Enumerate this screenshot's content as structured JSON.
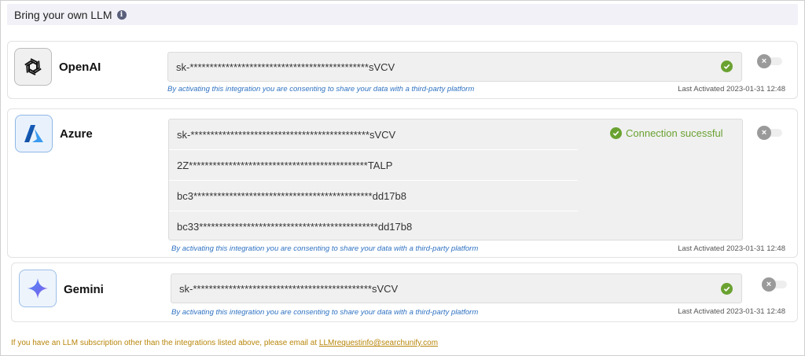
{
  "header": {
    "title": "Bring your own LLM",
    "info_icon": "i"
  },
  "providers": {
    "openai": {
      "name": "OpenAI",
      "key": "sk-*********************************************sVCV",
      "consent": "By activating this integration you are consenting to share your data with a third-party platform",
      "last_activated": "Last Activated 2023-01-31 12:48",
      "toggle_icon": "×"
    },
    "azure": {
      "name": "Azure",
      "keys": [
        "sk-*********************************************sVCV",
        "2Z*********************************************TALP",
        "bc3*********************************************dd17b8",
        "bc33*********************************************dd17b8"
      ],
      "status": "Connection sucessful",
      "consent": "By activating this integration you are consenting to share your data with a third-party platform",
      "last_activated": "Last Activated 2023-01-31 12:48",
      "toggle_icon": "×"
    },
    "gemini": {
      "name": "Gemini",
      "key": "sk-*********************************************sVCV",
      "consent": "By activating this integration you are consenting to share your data with a third-party platform",
      "last_activated": "Last Activated 2023-01-31 12:48",
      "toggle_icon": "×"
    }
  },
  "footer": {
    "text": "If you have an LLM subscription other than the integrations listed above, please email at ",
    "email": "LLMrequestinfo@searchunify.com"
  },
  "colors": {
    "success": "#6aa231",
    "consent_link": "#2f72c2",
    "footer_note": "#b8860b",
    "header_bg": "#f1f1f7"
  }
}
